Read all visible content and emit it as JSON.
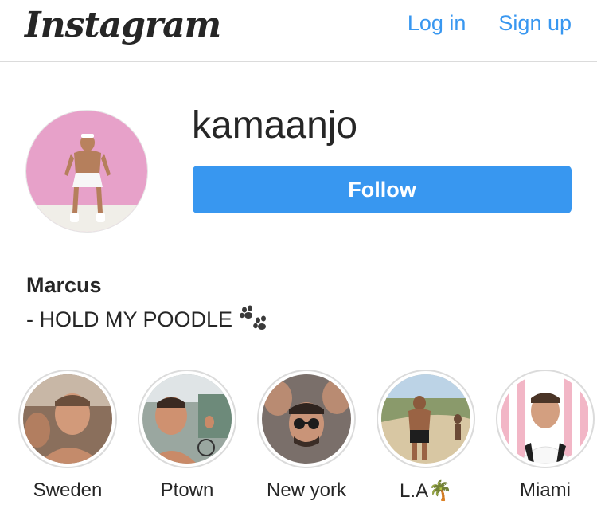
{
  "header": {
    "logo_text": "Instagram",
    "login_label": "Log in",
    "signup_label": "Sign up"
  },
  "profile": {
    "username": "kamaanjo",
    "follow_label": "Follow",
    "full_name": "Marcus",
    "bio": "- HOLD MY POODLE",
    "bio_emoji": "paw-prints-icon"
  },
  "highlights": [
    {
      "label": "Sweden"
    },
    {
      "label": "Ptown"
    },
    {
      "label": "New york"
    },
    {
      "label": "L.A🌴"
    },
    {
      "label": "Miami"
    }
  ],
  "colors": {
    "link_blue": "#3897f0",
    "button_blue": "#3897f0",
    "text": "#262626",
    "divider": "#dbdbdb"
  }
}
